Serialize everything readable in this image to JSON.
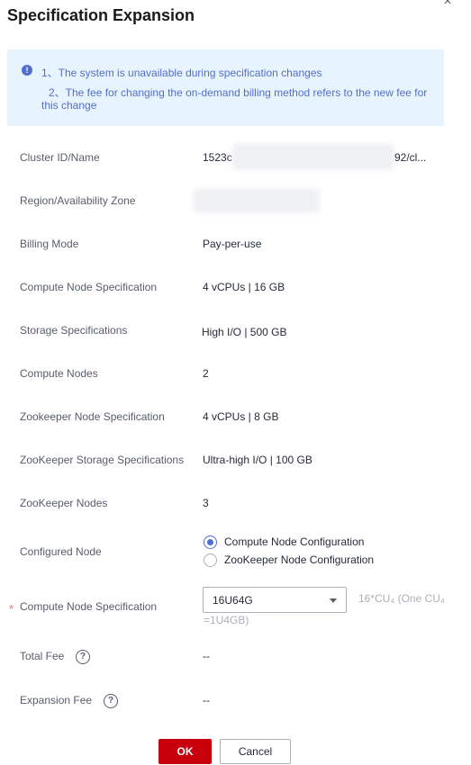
{
  "dialog": {
    "title": "Specification Expansion",
    "close_symbol": "×"
  },
  "notice": {
    "icon": "info-icon",
    "line1": "1、The system is unavailable during specification changes",
    "line2": "2、The fee for changing the on-demand billing method refers to the new fee for this change"
  },
  "fields": {
    "cluster_id": {
      "label": "Cluster ID/Name",
      "value_prefix": "1523c",
      "value_suffix": "92/cl..."
    },
    "region": {
      "label": "Region/Availability Zone"
    },
    "billing_mode": {
      "label": "Billing Mode",
      "value": "Pay-per-use"
    },
    "compute_node_spec": {
      "label": "Compute Node Specification",
      "value": "4 vCPUs | 16 GB"
    },
    "storage_spec": {
      "label": "Storage Specifications",
      "value": "High I/O | 500 GB"
    },
    "compute_nodes": {
      "label": "Compute Nodes",
      "value": "2"
    },
    "zookeeper_node_spec": {
      "label": "Zookeeper Node Specification",
      "value": "4 vCPUs | 8 GB"
    },
    "zookeeper_storage_spec": {
      "label": "ZooKeeper Storage Specifications",
      "value": "Ultra-high I/O | 100 GB"
    },
    "zookeeper_nodes": {
      "label": "ZooKeeper Nodes",
      "value": "3"
    }
  },
  "configured_node": {
    "label": "Configured Node",
    "options": [
      {
        "label": "Compute Node Configuration",
        "selected": true
      },
      {
        "label": "ZooKeeper Node Configuration",
        "selected": false
      }
    ]
  },
  "new_spec": {
    "required_mark": "*",
    "label": "Compute Node Specification",
    "selected": "16U64G",
    "hint_line1": "16*CU₄ (One CU₄",
    "hint_line2": "=1U4GB)"
  },
  "total_fee": {
    "label": "Total Fee",
    "value": "--",
    "help_symbol": "?"
  },
  "expansion_fee": {
    "label": "Expansion Fee",
    "value": "--",
    "help_symbol": "?"
  },
  "buttons": {
    "ok": "OK",
    "cancel": "Cancel"
  },
  "colors": {
    "brand": "#c7000b",
    "accent": "#526ecc",
    "notice_bg": "#e8f4fd"
  }
}
